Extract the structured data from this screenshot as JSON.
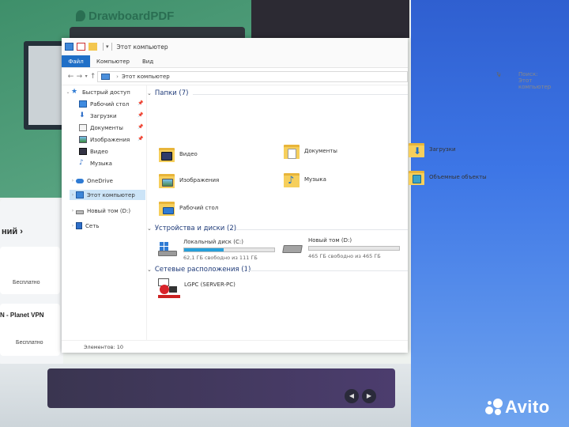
{
  "background": {
    "store_app_name": "DrawboardPDF",
    "store_section_heading": "ний",
    "store_items": [
      {
        "title": "",
        "price": "Бесплатно"
      },
      {
        "title": "N - Planet VPN",
        "price": "Бесплатно"
      }
    ],
    "watermark": "Avito",
    "colors": {
      "desktop_blue": "#3d76e6",
      "store_green": "#3e8f6a",
      "store_purple": "#4c3d6e"
    }
  },
  "explorer": {
    "window_title": "Этот компьютер",
    "ribbon_tabs": [
      {
        "label": "Файл",
        "active": true
      },
      {
        "label": "Компьютер",
        "active": false
      },
      {
        "label": "Вид",
        "active": false
      }
    ],
    "address": {
      "crumbs": [
        "Этот компьютер"
      ],
      "search_placeholder": "Поиск: Этот компьютер"
    },
    "nav_pane": {
      "quick_access": "Быстрый доступ",
      "quick_items": [
        {
          "label": "Рабочий стол",
          "pinned": true,
          "icon": "desktop-icon"
        },
        {
          "label": "Загрузки",
          "pinned": true,
          "icon": "download-icon"
        },
        {
          "label": "Документы",
          "pinned": true,
          "icon": "documents-icon"
        },
        {
          "label": "Изображения",
          "pinned": true,
          "icon": "pictures-icon"
        },
        {
          "label": "Видео",
          "pinned": false,
          "icon": "video-icon"
        },
        {
          "label": "Музыка",
          "pinned": false,
          "icon": "music-icon"
        }
      ],
      "onedrive": "OneDrive",
      "this_pc": "Этот компьютер",
      "new_volume": "Новый том (D:)",
      "network": "Сеть"
    },
    "groups": {
      "folders_header": "Папки (7)",
      "folders": [
        {
          "label": "Видео",
          "icon": "video-folder-icon"
        },
        {
          "label": "Документы",
          "icon": "documents-folder-icon"
        },
        {
          "label": "Загрузки",
          "icon": "downloads-folder-icon"
        },
        {
          "label": "Изображения",
          "icon": "pictures-folder-icon"
        },
        {
          "label": "Музыка",
          "icon": "music-folder-icon"
        },
        {
          "label": "Объемные объекты",
          "icon": "3d-objects-folder-icon"
        },
        {
          "label": "Рабочий стол",
          "icon": "desktop-folder-icon"
        }
      ],
      "drives_header": "Устройства и диски (2)",
      "drives": [
        {
          "label": "Локальный диск (C:)",
          "free_text": "62,1 ГБ свободно из 111 ГБ",
          "used_fraction": 0.44,
          "icon": "windows-drive-icon"
        },
        {
          "label": "Новый том (D:)",
          "free_text": "465 ГБ свободно из 465 ГБ",
          "used_fraction": 0.0,
          "icon": "hard-drive-icon"
        }
      ],
      "network_header": "Сетевые расположения (1)",
      "network_locations": [
        {
          "label": "LGPC (SERVER-PC)",
          "icon": "dlna-media-server-icon"
        }
      ]
    },
    "status": {
      "items_count": "Элементов: 10"
    },
    "colors": {
      "accent": "#1f6fc7",
      "selection": "#cce4f7",
      "drive_bar": "#26a0da",
      "folder": "#f6cf5c"
    }
  }
}
